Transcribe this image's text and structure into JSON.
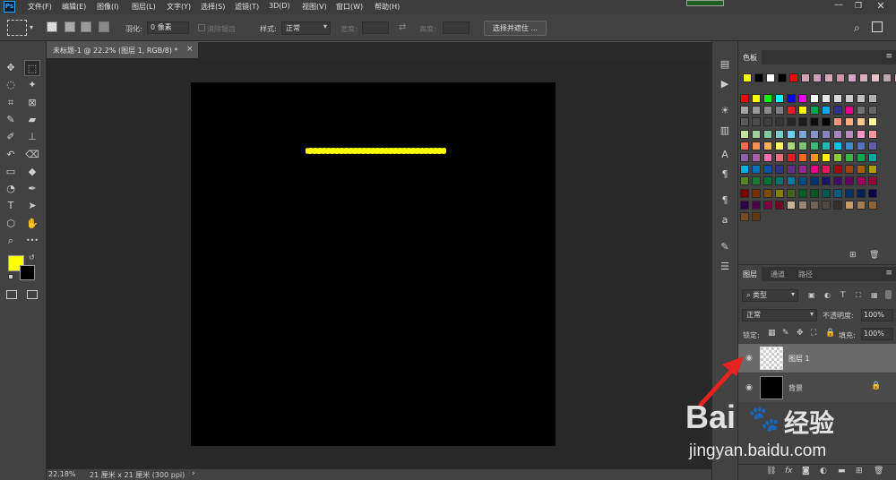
{
  "app": {
    "logo": "Ps"
  },
  "menu": [
    "文件(F)",
    "编辑(E)",
    "图像(I)",
    "图层(L)",
    "文字(Y)",
    "选择(S)",
    "滤镜(T)",
    "3D(D)",
    "视图(V)",
    "窗口(W)",
    "帮助(H)"
  ],
  "options": {
    "feather_label": "羽化:",
    "feather_value": "0 像素",
    "antialias_label": "消除锯齿",
    "style_label": "样式:",
    "style_value": "正常",
    "width_label": "宽度:",
    "height_label": "高度:",
    "select_mask_button": "选择并遮住 ..."
  },
  "document": {
    "tab_title": "未标题-1 @ 22.2% (图层 1, RGB/8) *",
    "close": "×"
  },
  "status": {
    "zoom": "22.18%",
    "doc_info": "21 厘米 x 21 厘米 (300 ppi)",
    "arrow": "›"
  },
  "swatches_panel": {
    "title": "色板",
    "recent": [
      "#ffff00",
      "#000000",
      "#ffffff",
      "#000000",
      "#ff0000",
      "#d4a0b0",
      "#c8a0b8",
      "#d8a8b8",
      "#c898a8",
      "#d0a8c0",
      "#d8b0c0",
      "#e8c0c8",
      "#c0a8b0",
      "#e0b0b8",
      "#f0a0a8"
    ],
    "grid": [
      [
        "#ff0000",
        "#ffff00",
        "#00ff00",
        "#00ffff",
        "#0000ff",
        "#ff00ff",
        "#ffffff",
        "#e6e6e6",
        "#d9d9d9",
        "#cccccc",
        "#bfbfbf",
        "#b3b3b3"
      ],
      [
        "#a6a6a6",
        "#999999",
        "#8c8c8c",
        "#808080",
        "#ed1c24",
        "#fff200",
        "#00a651",
        "#00aeef",
        "#2e3192",
        "#ec008c",
        "#737373",
        "#666666"
      ],
      [
        "#595959",
        "#4d4d4d",
        "#404040",
        "#333333",
        "#262626",
        "#1a1a1a",
        "#0d0d0d",
        "#000000",
        "#f7977a",
        "#f9ad81",
        "#fdc68a",
        "#fff79a"
      ],
      [
        "#c4df9b",
        "#a2d39c",
        "#82ca9d",
        "#7bcdc8",
        "#6ecff6",
        "#7ea7d8",
        "#8493ca",
        "#8882be",
        "#a187be",
        "#bc8dbf",
        "#f49ac2",
        "#f6989d"
      ],
      [
        "#f26c4f",
        "#f68e55",
        "#fbaf5c",
        "#fff467",
        "#acd372",
        "#7cc576",
        "#3bb878",
        "#1abbb4",
        "#00bff3",
        "#438cca",
        "#5574b9",
        "#605ca8"
      ],
      [
        "#855fa8",
        "#a763a8",
        "#f06ea9",
        "#f26d7d",
        "#ed1c24",
        "#f26522",
        "#f7941d",
        "#fff200",
        "#8dc63f",
        "#39b54a",
        "#00a651",
        "#00a99d"
      ],
      [
        "#00aeef",
        "#0072bc",
        "#0054a6",
        "#2e3192",
        "#662d91",
        "#92278f",
        "#ec008c",
        "#ed145b",
        "#9e0b0f",
        "#a0410d",
        "#a36209",
        "#aba000"
      ],
      [
        "#598527",
        "#1a7b30",
        "#007236",
        "#00746b",
        "#0076a3",
        "#004a80",
        "#003471",
        "#1b1464",
        "#440e62",
        "#630460",
        "#9e005d",
        "#9e0039"
      ],
      [
        "#790000",
        "#7b2e00",
        "#7d4900",
        "#827b00",
        "#406618",
        "#005e20",
        "#005826",
        "#005952",
        "#005b7f",
        "#003663",
        "#002157",
        "#0d004c"
      ],
      [
        "#32004b",
        "#4b0049",
        "#7b0046",
        "#7a0026",
        "#c7b299",
        "#998675",
        "#736357",
        "#534741",
        "#37302a",
        "#c69c6d",
        "#a67c52",
        "#8c6239"
      ],
      [
        "#754c24",
        "#603913"
      ]
    ]
  },
  "layers_panel": {
    "tabs": [
      "图层",
      "通道",
      "路径"
    ],
    "filter_label": "类型",
    "blend_mode": "正常",
    "opacity_label": "不透明度:",
    "opacity_value": "100%",
    "lock_label": "锁定:",
    "fill_label": "填充:",
    "fill_value": "100%",
    "layers": [
      {
        "name": "图层 1",
        "selected": true,
        "thumb": "transparent"
      },
      {
        "name": "背景",
        "selected": false,
        "thumb": "black"
      }
    ],
    "footer_icons": [
      "link-icon",
      "fx-icon",
      "mask-icon",
      "adjustment-icon",
      "group-icon",
      "new-layer-icon",
      "trash-icon"
    ],
    "fx_text": "fx"
  },
  "colors": {
    "foreground": "#ffff00",
    "background": "#000000",
    "arrow": "#e8231f"
  },
  "watermark": {
    "brand": "Bai",
    "brand2": "经验",
    "url": "jingyan.baidu.com"
  }
}
